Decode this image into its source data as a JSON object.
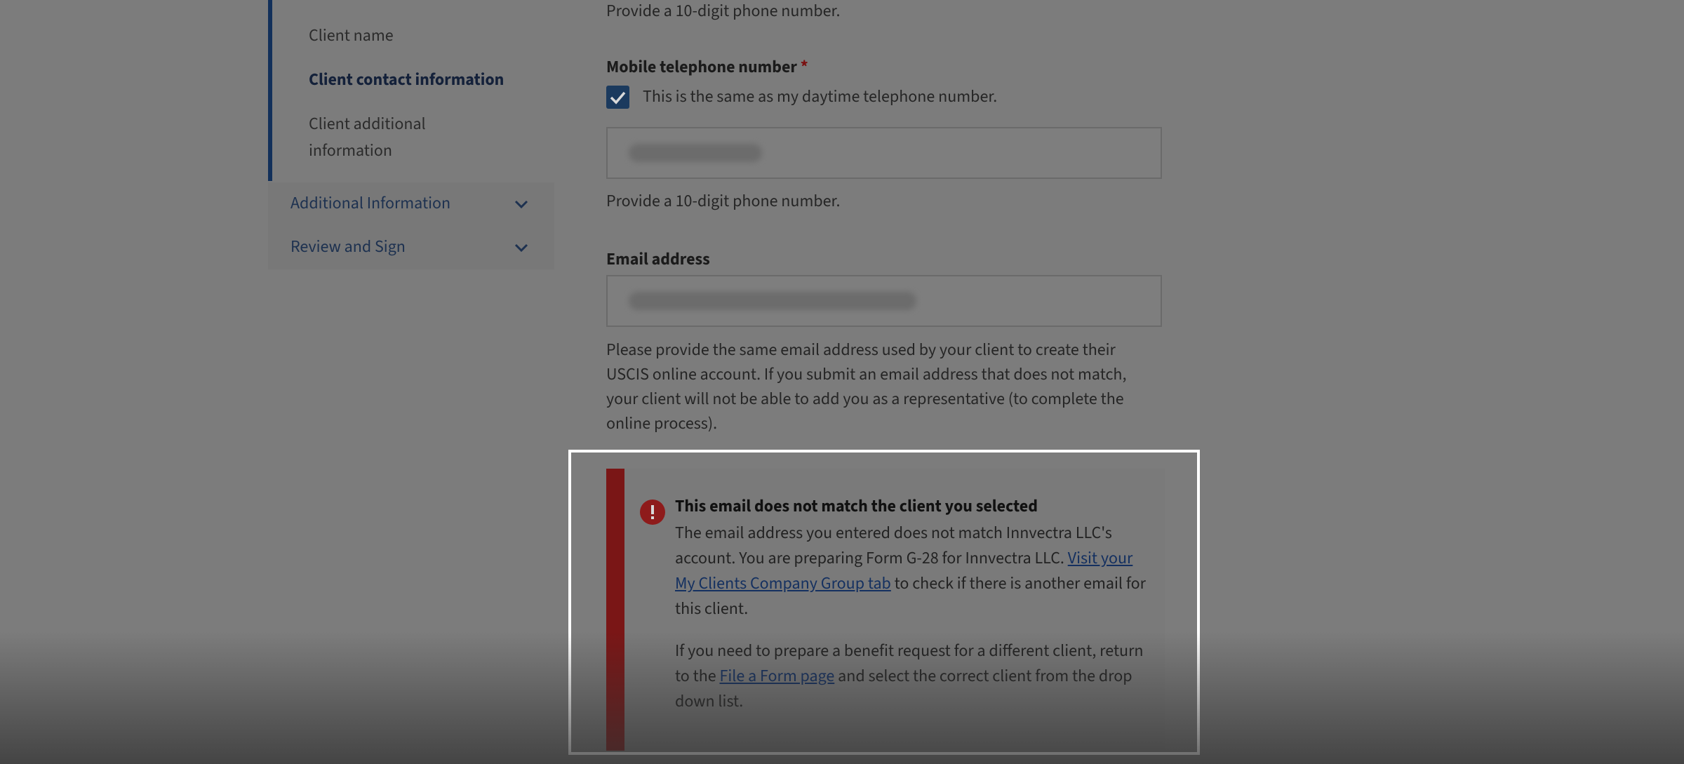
{
  "sidebar": {
    "sub_items": [
      {
        "label": "Client name"
      },
      {
        "label": "Client contact information"
      },
      {
        "label": "Client additional information"
      }
    ],
    "categories": [
      {
        "label": "Additional Information"
      },
      {
        "label": "Review and Sign"
      }
    ]
  },
  "form": {
    "top_hint": "Provide a 10-digit phone number.",
    "mobile_label": "Mobile telephone number",
    "required_mark": "*",
    "same_checkbox_label": "This is the same as my daytime telephone number.",
    "mobile_hint": "Provide a 10-digit phone number.",
    "email_label": "Email address",
    "email_help": "Please provide the same email address used by your client to create their USCIS online account. If you submit an email address that does not match, your client will not be able to add you as a representative (to complete the online process)."
  },
  "alert": {
    "title": "This email does not match the client you selected",
    "p1_text": "The email address you entered does not match Innvectra LLC's account. You are preparing Form G-28 for Innvectra LLC.",
    "p1_link": "Visit your My Clients Company Group tab",
    "p1_tail": "to check if there is another email for this client.",
    "p2_text": "If you need to prepare a benefit request for a different client, return to the",
    "p2_link": "File a Form page",
    "p2_tail": "and select the correct client from the drop down list."
  },
  "colors": {
    "accent": "#12305a",
    "error": "#7a1616",
    "highlight_border": "#ffffff"
  }
}
